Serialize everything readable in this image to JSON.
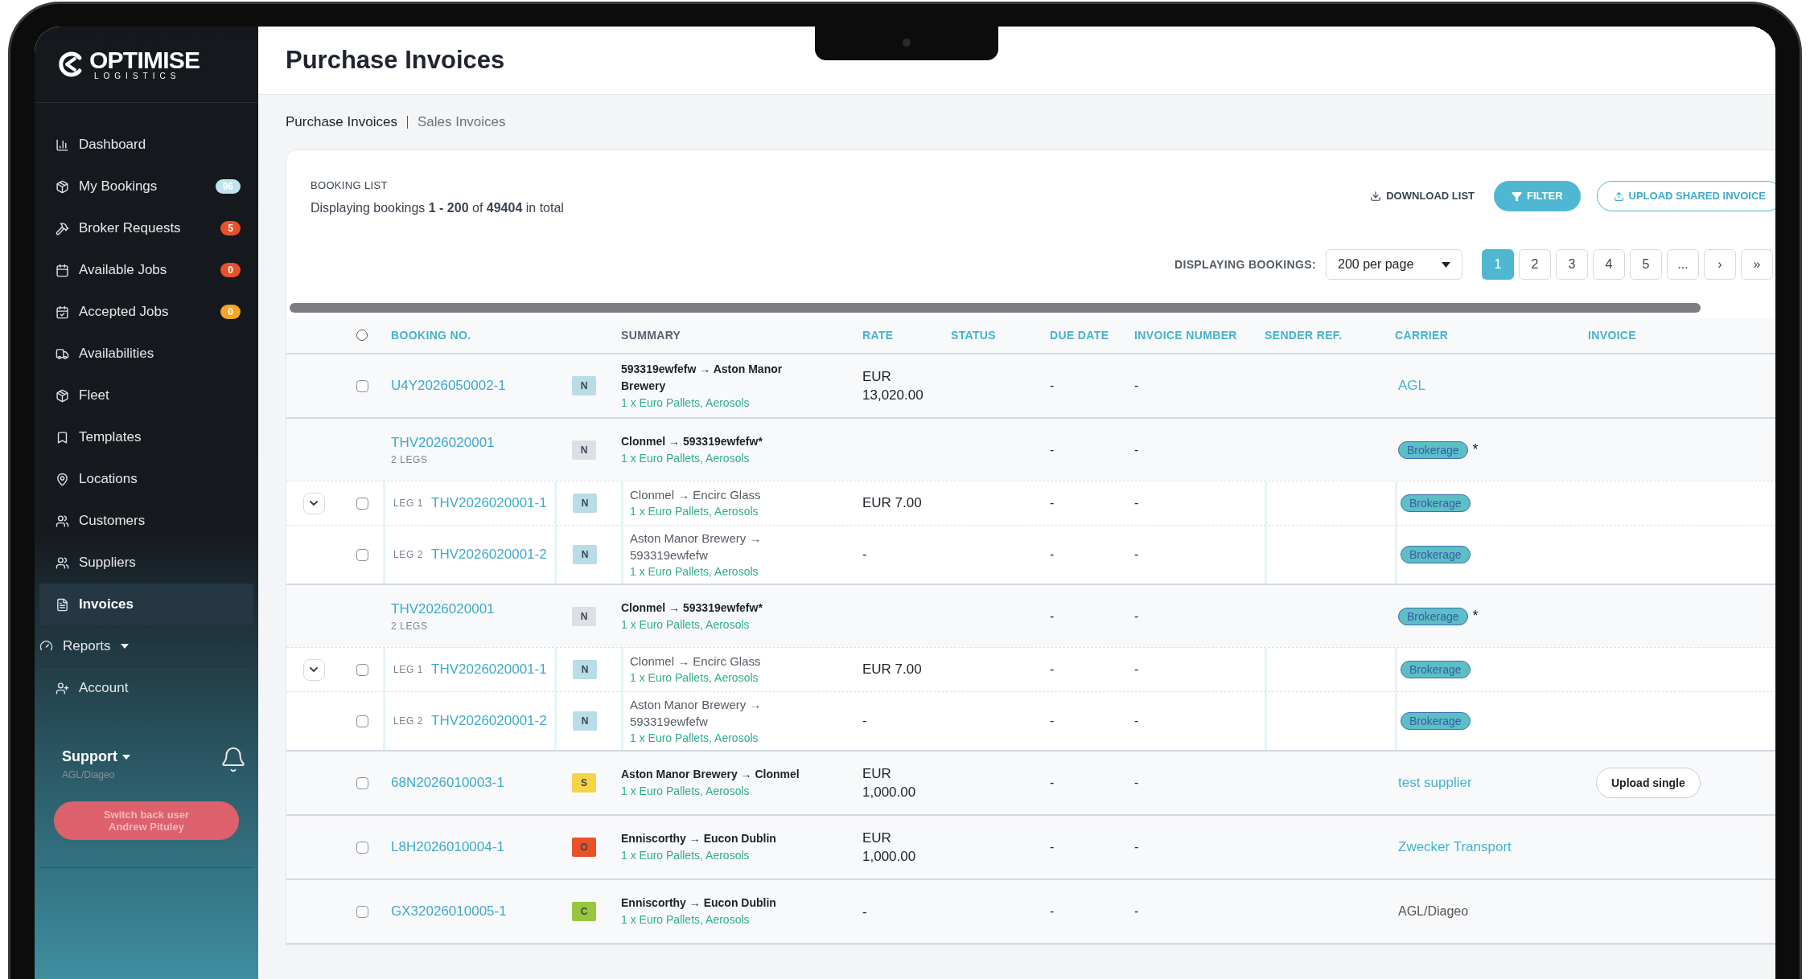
{
  "sidebar": {
    "logo": {
      "name": "OPTIMISE",
      "tagline": "LOGISTICS"
    },
    "items": [
      {
        "label": "Dashboard",
        "selected": false
      },
      {
        "label": "My Bookings",
        "badge": "96",
        "color": "#bfe3ef",
        "selected": false
      },
      {
        "label": "Broker Requests",
        "badge": "5",
        "color": "#e9512b",
        "selected": false
      },
      {
        "label": "Available Jobs",
        "badge": "0",
        "color": "#e9512b",
        "selected": false
      },
      {
        "label": "Accepted Jobs",
        "badge": "0",
        "color": "#f5a623",
        "selected": false
      },
      {
        "label": "Availabilities",
        "selected": false
      },
      {
        "label": "Fleet",
        "selected": false
      },
      {
        "label": "Templates",
        "selected": false
      },
      {
        "label": "Locations",
        "selected": false
      },
      {
        "label": "Customers",
        "selected": false
      },
      {
        "label": "Suppliers",
        "selected": false
      },
      {
        "label": "Invoices",
        "selected": true
      },
      {
        "label": "Reports",
        "caret": true,
        "selected": false
      },
      {
        "label": "Account",
        "selected": false
      }
    ],
    "support": {
      "label": "Support",
      "company": "AGL/Diageo"
    },
    "switch_button": "Switch back user Andrew Pituley"
  },
  "page_title": "Purchase Invoices",
  "subtabs": [
    {
      "label": "Purchase Invoices",
      "selected": true
    },
    {
      "label": "Sales Invoices",
      "selected": false
    }
  ],
  "booking_list": {
    "heading": "BOOKING LIST",
    "summary": "Displaying bookings **1 - 200** of **49404** in total",
    "actions": [
      {
        "label": "DOWNLOAD LIST",
        "kind": "plain"
      },
      {
        "label": "FILTER",
        "kind": "filled"
      },
      {
        "label": "UPLOAD SHARED INVOICE",
        "kind": "outline"
      }
    ],
    "per_page_label": "DISPLAYING BOOKINGS:",
    "per_page": "200 per page",
    "pages": [
      {
        "label": "1",
        "selected": true
      },
      {
        "label": "2",
        "selected": false
      },
      {
        "label": "3",
        "selected": false
      },
      {
        "label": "4",
        "selected": false
      },
      {
        "label": "5",
        "selected": false
      },
      {
        "label": "...",
        "selected": false
      },
      {
        "label": "›",
        "selected": false
      },
      {
        "label": "»",
        "selected": false
      }
    ]
  },
  "table": {
    "select_all_checked": false,
    "columns": [
      {
        "label": "BOOKING NO.",
        "sortable": true
      },
      {
        "label": "SUMMARY",
        "sortable": false
      },
      {
        "label": "RATE",
        "sortable": true
      },
      {
        "label": "STATUS",
        "sortable": true
      },
      {
        "label": "DUE DATE",
        "sortable": true
      },
      {
        "label": "INVOICE NUMBER",
        "sortable": true
      },
      {
        "label": "SENDER REF.",
        "sortable": true
      },
      {
        "label": "CARRIER",
        "sortable": true
      },
      {
        "label": "INVOICE",
        "sortable": true
      }
    ],
    "rows": [
      {
        "kind": "booking",
        "checked": false,
        "booking_no": "U4Y2026050002-1",
        "badge": "N",
        "color": "#b9dce6",
        "route": "593319ewfefw → Aston Manor Brewery",
        "cargo": "1 x Euro Pallets, Aerosols",
        "rate": "EUR 13,020.00",
        "due_date": "-",
        "invoice_number": "-",
        "carrier": {
          "text": "AGL",
          "kind": "link"
        }
      },
      {
        "kind": "group",
        "booking_no": "THV2026020001",
        "legs_label": "2 LEGS",
        "badge": "N",
        "color": "#dcdfe3",
        "route": "Clonmel → 593319ewfefw*",
        "cargo": "1 x Euro Pallets, Aerosols",
        "due_date": "-",
        "invoice_number": "-",
        "carrier": {
          "text": "Brokerage",
          "kind": "tag",
          "mark": "*"
        },
        "expanded": true,
        "legs": [
          {
            "leg": "LEG 1",
            "checked": false,
            "booking_no": "THV2026020001-1",
            "badge": "N",
            "color": "#b9dce6",
            "route": "Clonmel → Encirc Glass",
            "cargo": "1 x Euro Pallets, Aerosols",
            "rate": "EUR 7.00",
            "due_date": "-",
            "invoice_number": "-",
            "carrier": {
              "text": "Brokerage",
              "kind": "tag"
            }
          },
          {
            "leg": "LEG 2",
            "checked": false,
            "booking_no": "THV2026020001-2",
            "badge": "N",
            "color": "#b9dce6",
            "route": "Aston Manor Brewery → 593319ewfefw",
            "cargo": "1 x Euro Pallets, Aerosols",
            "rate": "-",
            "due_date": "-",
            "invoice_number": "-",
            "carrier": {
              "text": "Brokerage",
              "kind": "tag"
            }
          }
        ]
      },
      {
        "kind": "group",
        "booking_no": "THV2026020001",
        "legs_label": "2 LEGS",
        "badge": "N",
        "color": "#dcdfe3",
        "route": "Clonmel → 593319ewfefw*",
        "cargo": "1 x Euro Pallets, Aerosols",
        "due_date": "-",
        "invoice_number": "-",
        "carrier": {
          "text": "Brokerage",
          "kind": "tag",
          "mark": "*"
        },
        "expanded": true,
        "legs": [
          {
            "leg": "LEG 1",
            "checked": false,
            "booking_no": "THV2026020001-1",
            "badge": "N",
            "color": "#b9dce6",
            "route": "Clonmel → Encirc Glass",
            "cargo": "1 x Euro Pallets, Aerosols",
            "rate": "EUR 7.00",
            "due_date": "-",
            "invoice_number": "-",
            "carrier": {
              "text": "Brokerage",
              "kind": "tag"
            }
          },
          {
            "leg": "LEG 2",
            "checked": false,
            "booking_no": "THV2026020001-2",
            "badge": "N",
            "color": "#b9dce6",
            "route": "Aston Manor Brewery → 593319ewfefw",
            "cargo": "1 x Euro Pallets, Aerosols",
            "rate": "-",
            "due_date": "-",
            "invoice_number": "-",
            "carrier": {
              "text": "Brokerage",
              "kind": "tag"
            }
          }
        ]
      },
      {
        "kind": "booking",
        "checked": false,
        "booking_no": "68N2026010003-1",
        "badge": "S",
        "color": "#f5d547",
        "route": "Aston Manor Brewery → Clonmel",
        "cargo": "1 x Euro Pallets, Aerosols",
        "rate": "EUR 1,000.00",
        "due_date": "-",
        "invoice_number": "-",
        "carrier": {
          "text": "test supplier",
          "kind": "link"
        },
        "invoice_button": "Upload single"
      },
      {
        "kind": "booking",
        "checked": false,
        "booking_no": "L8H2026010004-1",
        "badge": "O",
        "color": "#e9512b",
        "route": "Enniscorthy → Eucon Dublin",
        "cargo": "1 x Euro Pallets, Aerosols",
        "rate": "EUR 1,000.00",
        "due_date": "-",
        "invoice_number": "-",
        "carrier": {
          "text": "Zwecker Transport",
          "kind": "link"
        }
      },
      {
        "kind": "booking",
        "checked": false,
        "booking_no": "GX32026010005-1",
        "badge": "C",
        "color": "#9bc53d",
        "route": "Enniscorthy → Eucon Dublin",
        "cargo": "1 x Euro Pallets, Aerosols",
        "rate": "-",
        "due_date": "-",
        "invoice_number": "-",
        "carrier": {
          "text": "AGL/Diageo",
          "kind": "plain"
        }
      }
    ]
  }
}
